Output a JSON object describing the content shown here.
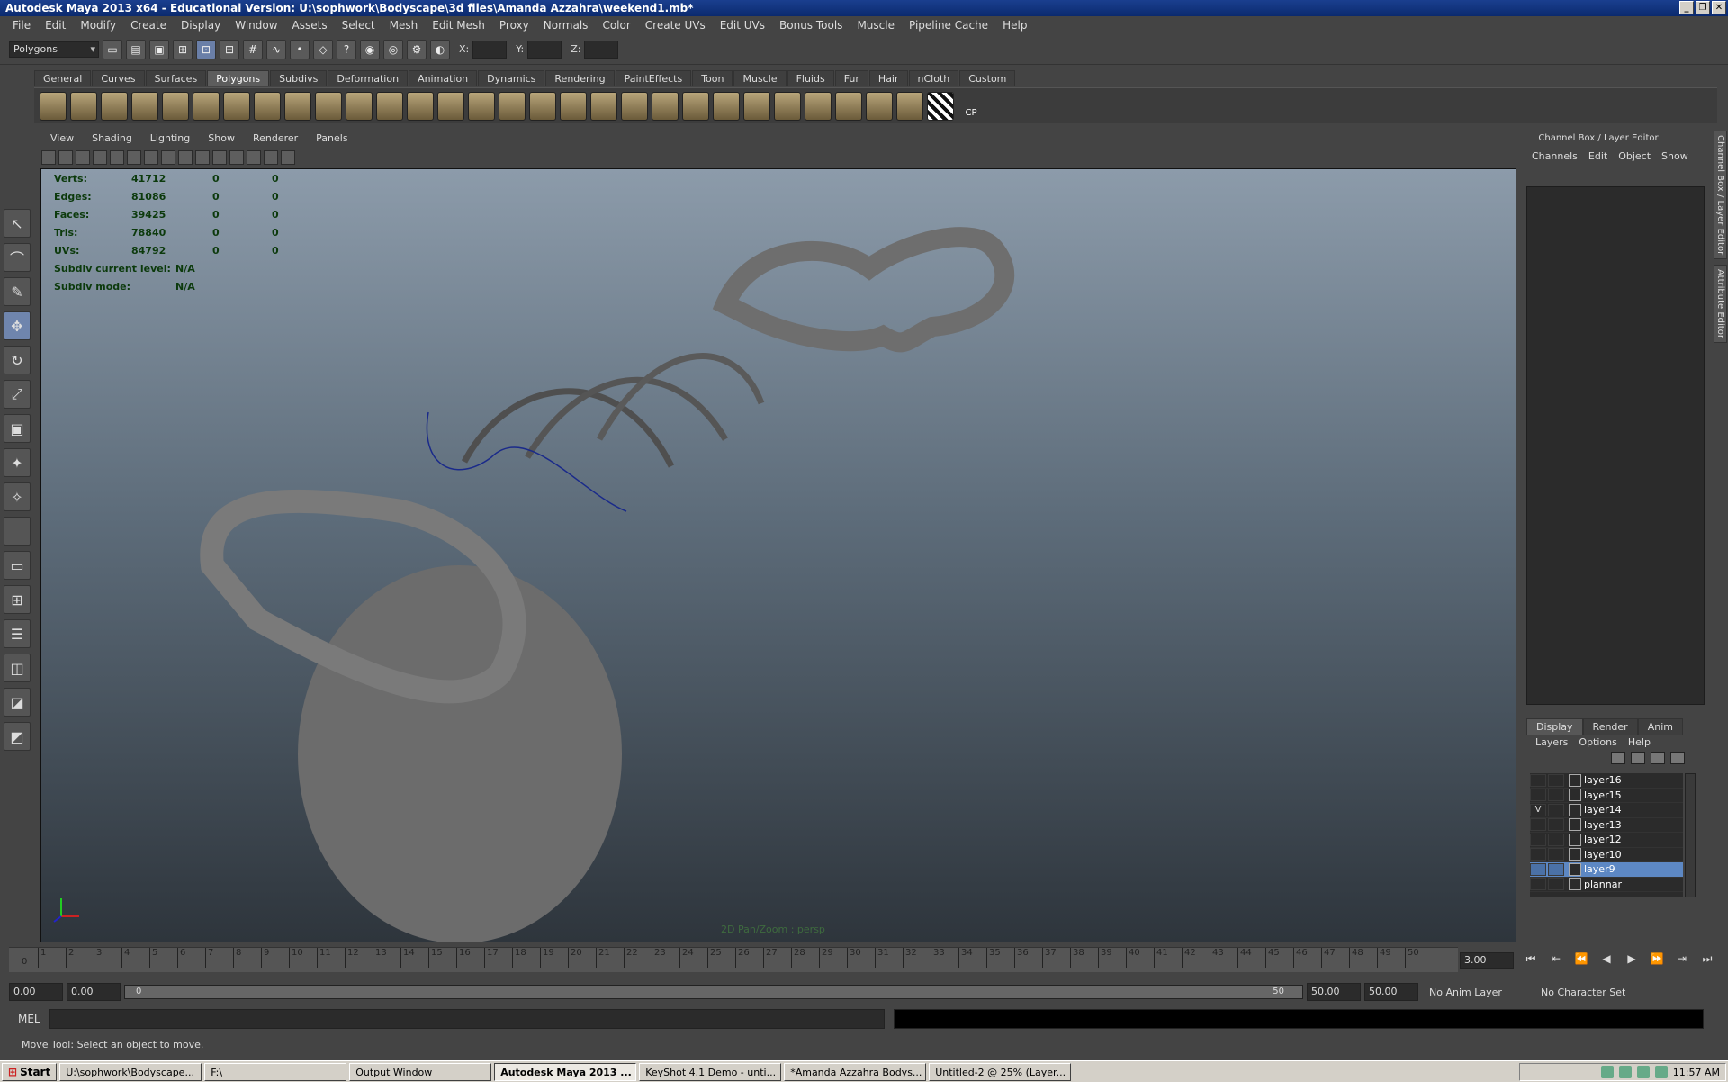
{
  "window": {
    "title": "Autodesk Maya 2013 x64 - Educational Version: U:\\sophwork\\Bodyscape\\3d files\\Amanda Azzahra\\weekend1.mb*"
  },
  "menus": [
    "File",
    "Edit",
    "Modify",
    "Create",
    "Display",
    "Window",
    "Assets",
    "Select",
    "Mesh",
    "Edit Mesh",
    "Proxy",
    "Normals",
    "Color",
    "Create UVs",
    "Edit UVs",
    "Bonus Tools",
    "Muscle",
    "Pipeline Cache",
    "Help"
  ],
  "statusline": {
    "mode": "Polygons",
    "x_label": "X:",
    "y_label": "Y:",
    "z_label": "Z:"
  },
  "shelf_tabs": [
    "General",
    "Curves",
    "Surfaces",
    "Polygons",
    "Subdivs",
    "Deformation",
    "Animation",
    "Dynamics",
    "Rendering",
    "PaintEffects",
    "Toon",
    "Muscle",
    "Fluids",
    "Fur",
    "Hair",
    "nCloth",
    "Custom"
  ],
  "shelf_active": "Polygons",
  "shelf_cp_label": "CP",
  "panel_menu": [
    "View",
    "Shading",
    "Lighting",
    "Show",
    "Renderer",
    "Panels"
  ],
  "hud": {
    "verts": {
      "label": "Verts:",
      "a": "41712",
      "b": "0",
      "c": "0"
    },
    "edges": {
      "label": "Edges:",
      "a": "81086",
      "b": "0",
      "c": "0"
    },
    "faces": {
      "label": "Faces:",
      "a": "39425",
      "b": "0",
      "c": "0"
    },
    "tris": {
      "label": "Tris:",
      "a": "78840",
      "b": "0",
      "c": "0"
    },
    "uvs": {
      "label": "UVs:",
      "a": "84792",
      "b": "0",
      "c": "0"
    },
    "subdiv_level": {
      "label": "Subdiv current level:",
      "value": "N/A"
    },
    "subdiv_mode": {
      "label": "Subdiv mode:",
      "value": "N/A"
    }
  },
  "camera_label": "2D Pan/Zoom : persp",
  "channel_box": {
    "title": "Channel Box / Layer Editor",
    "menu": [
      "Channels",
      "Edit",
      "Object",
      "Show"
    ]
  },
  "layer_editor": {
    "tabs": [
      "Display",
      "Render",
      "Anim"
    ],
    "active_tab": "Display",
    "menu": [
      "Layers",
      "Options",
      "Help"
    ],
    "layers": [
      {
        "name": "layer16",
        "vis": ""
      },
      {
        "name": "layer15",
        "vis": ""
      },
      {
        "name": "layer14",
        "vis": "V"
      },
      {
        "name": "layer13",
        "vis": ""
      },
      {
        "name": "layer12",
        "vis": ""
      },
      {
        "name": "layer10",
        "vis": ""
      },
      {
        "name": "layer9",
        "vis": ""
      },
      {
        "name": "plannar",
        "vis": ""
      }
    ],
    "selected": "layer9"
  },
  "side_tabs": [
    "Channel Box / Layer Editor",
    "Attribute Editor"
  ],
  "timeline": {
    "ticks": [
      "1",
      "2",
      "3",
      "4",
      "5",
      "6",
      "7",
      "8",
      "9",
      "10",
      "11",
      "12",
      "13",
      "14",
      "15",
      "16",
      "17",
      "18",
      "19",
      "20",
      "21",
      "22",
      "23",
      "24",
      "25",
      "26",
      "27",
      "28",
      "29",
      "30",
      "31",
      "32",
      "33",
      "34",
      "35",
      "36",
      "37",
      "38",
      "39",
      "40",
      "41",
      "42",
      "43",
      "44",
      "45",
      "46",
      "47",
      "48",
      "49",
      "50"
    ],
    "start_label": "0",
    "current_frame": "3.00"
  },
  "range": {
    "start": "0.00",
    "min": "0.00",
    "slider_left": "0",
    "slider_right": "50",
    "end": "50.00",
    "max": "50.00",
    "anim_layer": "No Anim Layer",
    "character_set": "No Character Set"
  },
  "mel_label": "MEL",
  "help_line": "Move Tool: Select an object to move.",
  "taskbar": {
    "start": "Start",
    "tasks": [
      {
        "label": "U:\\sophwork\\Bodyscape...",
        "active": false
      },
      {
        "label": "F:\\",
        "active": false
      },
      {
        "label": "Output Window",
        "active": false
      },
      {
        "label": "Autodesk Maya 2013 ...",
        "active": true
      },
      {
        "label": "KeyShot 4.1 Demo  - unti...",
        "active": false
      },
      {
        "label": "*Amanda Azzahra Bodys...",
        "active": false
      },
      {
        "label": "Untitled-2 @ 25% (Layer...",
        "active": false
      }
    ],
    "clock": "11:57 AM"
  },
  "colors": {
    "viewport_top": "#8c9baa",
    "viewport_bottom": "#2e353c",
    "hud_text": "#0c3a0c",
    "selection": "#5d88c4",
    "title_bar": "#0b2a6e"
  }
}
